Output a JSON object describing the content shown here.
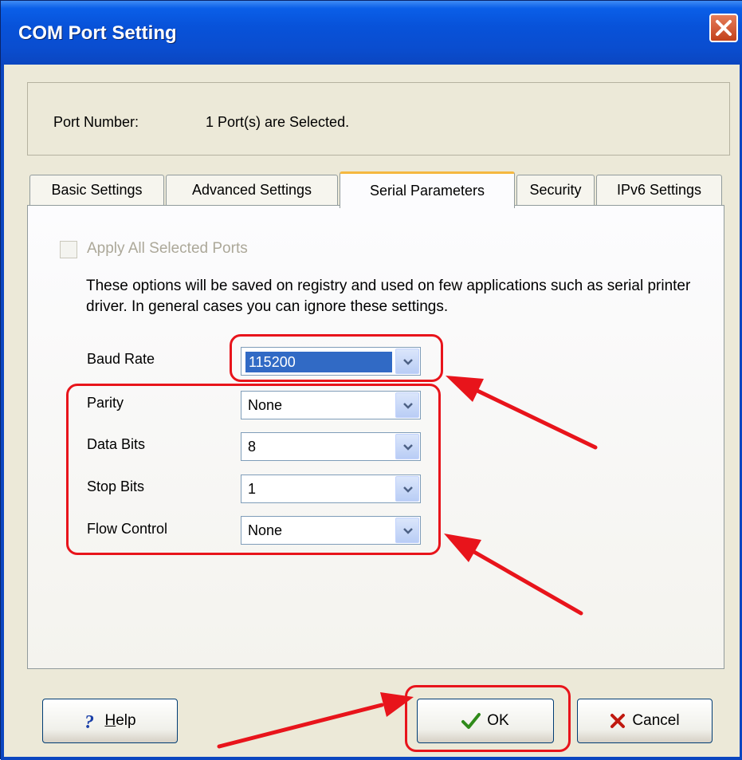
{
  "window": {
    "title": "COM Port Setting"
  },
  "port": {
    "label": "Port Number:",
    "value": "1 Port(s) are Selected."
  },
  "tabs": [
    {
      "label": "Basic Settings"
    },
    {
      "label": "Advanced Settings"
    },
    {
      "label": "Serial Parameters",
      "active": true
    },
    {
      "label": "Security"
    },
    {
      "label": "IPv6 Settings"
    }
  ],
  "panel": {
    "apply_all_label": "Apply All Selected Ports",
    "description": "These options will be saved on registry and used on few applications such as serial printer driver. In general cases you can ignore these settings.",
    "fields": [
      {
        "label": "Baud Rate",
        "value": "115200"
      },
      {
        "label": "Parity",
        "value": "None"
      },
      {
        "label": "Data Bits",
        "value": "8"
      },
      {
        "label": "Stop Bits",
        "value": "1"
      },
      {
        "label": "Flow Control",
        "value": "None"
      }
    ]
  },
  "buttons": {
    "help_accel": "H",
    "help_rest": "elp",
    "ok": "OK",
    "cancel": "Cancel"
  },
  "icons": {
    "close": "close-icon",
    "help": "question-mark-icon",
    "ok": "checkmark-icon",
    "cancel": "x-icon",
    "dropdown": "chevron-down-icon"
  },
  "colors": {
    "title_bar": "#0a4dcf",
    "face": "#ece9d8",
    "highlight_annotation": "#e8141b",
    "selection": "#316ac5"
  }
}
